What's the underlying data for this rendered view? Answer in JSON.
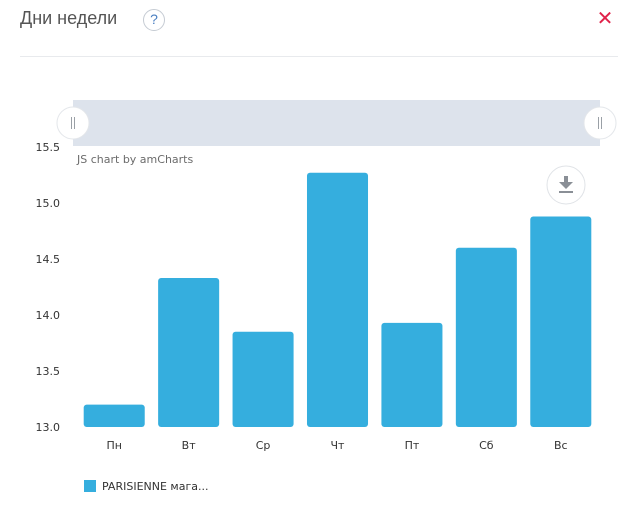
{
  "header": {
    "title": "Дни недели",
    "help_label": "?",
    "close_label": "✕"
  },
  "icons": {
    "help": "question-mark-icon",
    "close": "close-x-icon",
    "download": "download-icon",
    "scroll_grip": "grip-icon"
  },
  "colors": {
    "bar": "#35aede",
    "close": "#e0224a",
    "scrollbar": "#dde3ec"
  },
  "chart_credit": "JS chart by amCharts",
  "chart_data": {
    "type": "bar",
    "title": "",
    "xlabel": "",
    "ylabel": "",
    "categories": [
      "Пн",
      "Вт",
      "Ср",
      "Чт",
      "Пт",
      "Сб",
      "Вс"
    ],
    "series": [
      {
        "name": "PARISIENNE мага...",
        "values": [
          13.2,
          14.33,
          13.85,
          15.27,
          13.93,
          14.6,
          14.88
        ]
      }
    ],
    "ylim": [
      13.0,
      15.5
    ],
    "yticks": [
      "13.0",
      "13.5",
      "14.0",
      "14.5",
      "15.0",
      "15.5"
    ],
    "grid": false,
    "legend": "bottom-left"
  }
}
